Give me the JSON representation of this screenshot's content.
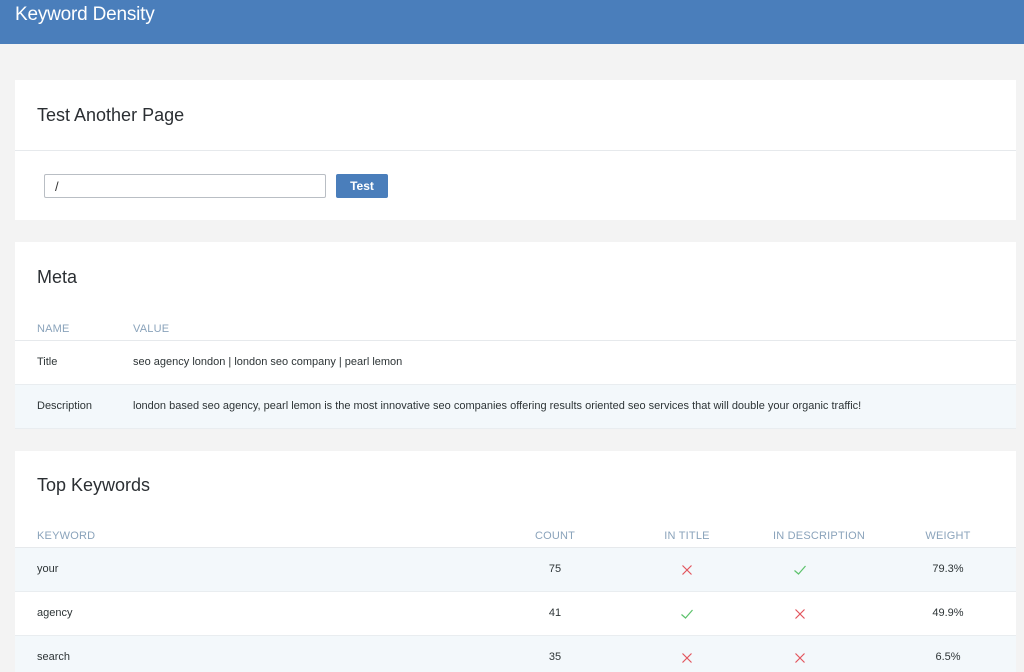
{
  "header": {
    "title": "Keyword Density"
  },
  "test_card": {
    "title": "Test Another Page",
    "input_value": "/",
    "button_label": "Test"
  },
  "meta_card": {
    "title": "Meta",
    "columns": {
      "name": "NAME",
      "value": "VALUE"
    },
    "rows": [
      {
        "name": "Title",
        "value": "seo agency london | london seo company | pearl lemon"
      },
      {
        "name": "Description",
        "value": "london based seo agency, pearl lemon is the most innovative seo companies offering results oriented seo services that will double your organic traffic!"
      }
    ]
  },
  "keywords_card": {
    "title": "Top Keywords",
    "columns": {
      "keyword": "KEYWORD",
      "count": "COUNT",
      "in_title": "IN TITLE",
      "in_description": "IN DESCRIPTION",
      "weight": "WEIGHT"
    },
    "rows": [
      {
        "keyword": "your",
        "count": "75",
        "in_title": false,
        "in_description": true,
        "weight": "79.3%"
      },
      {
        "keyword": "agency",
        "count": "41",
        "in_title": true,
        "in_description": false,
        "weight": "49.9%"
      },
      {
        "keyword": "search",
        "count": "35",
        "in_title": false,
        "in_description": false,
        "weight": "6.5%"
      }
    ]
  },
  "colors": {
    "accent": "#4a7ebb",
    "check": "#5cc26b",
    "cross": "#e2545d"
  },
  "icons": {
    "check": "check-icon",
    "cross": "cross-icon"
  }
}
